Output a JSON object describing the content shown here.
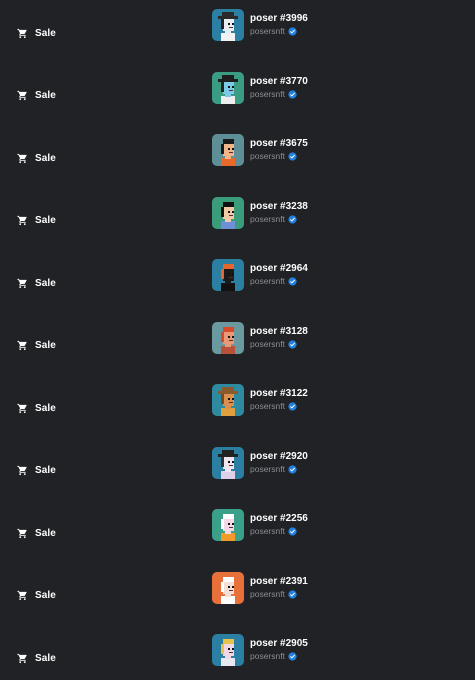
{
  "event_label": "Sale",
  "collection": "posersnft",
  "colors": {
    "background": "#202225",
    "text": "#ffffff",
    "muted": "#8a8d93",
    "verified": "#2081e2"
  },
  "icons": {
    "event": "shopping-cart-icon",
    "verified": "verified-badge-icon"
  },
  "rows": [
    {
      "event": "Sale",
      "name": "poser #3996",
      "collection": "posersnft",
      "thumb_bg": "#2b7fa3",
      "skin": "#e8eef2",
      "hair": "#222222",
      "hat": "#2a2a2a",
      "shirt": "#f2f2f2"
    },
    {
      "event": "Sale",
      "name": "poser #3770",
      "collection": "posersnft",
      "thumb_bg": "#3a9c83",
      "skin": "#7fc9e8",
      "hair": "#222222",
      "hat": "#1e1e1e",
      "shirt": "#eeeeee"
    },
    {
      "event": "Sale",
      "name": "poser #3675",
      "collection": "posersnft",
      "thumb_bg": "#5e8e96",
      "skin": "#f0b58a",
      "hair": "#1a1a1a",
      "hat": "",
      "shirt": "#e86a2b"
    },
    {
      "event": "Sale",
      "name": "poser #3238",
      "collection": "posersnft",
      "thumb_bg": "#3a9c7a",
      "skin": "#f2c9a6",
      "hair": "#111111",
      "hat": "",
      "shirt": "#6c8fd6"
    },
    {
      "event": "Sale",
      "name": "poser #2964",
      "collection": "posersnft",
      "thumb_bg": "#2b7fa3",
      "skin": "#1a1a1a",
      "hair": "#e8652b",
      "hat": "",
      "shirt": "#111111"
    },
    {
      "event": "Sale",
      "name": "poser #3128",
      "collection": "posersnft",
      "thumb_bg": "#6a9aa0",
      "skin": "#e89a78",
      "hair": "#d94a2a",
      "hat": "",
      "shirt": "#b8503a"
    },
    {
      "event": "Sale",
      "name": "poser #3122",
      "collection": "posersnft",
      "thumb_bg": "#2d8aa0",
      "skin": "#d99050",
      "hair": "#7a4a1e",
      "hat": "#8a5a2a",
      "shirt": "#e0a040"
    },
    {
      "event": "Sale",
      "name": "poser #2920",
      "collection": "posersnft",
      "thumb_bg": "#2b7fa3",
      "skin": "#f0e6f0",
      "hair": "#333333",
      "hat": "#222222",
      "shirt": "#ddd0e8"
    },
    {
      "event": "Sale",
      "name": "poser #2256",
      "collection": "posersnft",
      "thumb_bg": "#3aa08a",
      "skin": "#f4d8e6",
      "hair": "#ffffff",
      "hat": "",
      "shirt": "#f29a2a"
    },
    {
      "event": "Sale",
      "name": "poser #2391",
      "collection": "posersnft",
      "thumb_bg": "#e8703a",
      "skin": "#f2e0d6",
      "hair": "#ffffff",
      "hat": "",
      "shirt": "#ffffff"
    },
    {
      "event": "Sale",
      "name": "poser #2905",
      "collection": "posersnft",
      "thumb_bg": "#2b7fa3",
      "skin": "#f2d8e6",
      "hair": "#e8c24a",
      "hat": "",
      "shirt": "#e8e8f0"
    }
  ]
}
